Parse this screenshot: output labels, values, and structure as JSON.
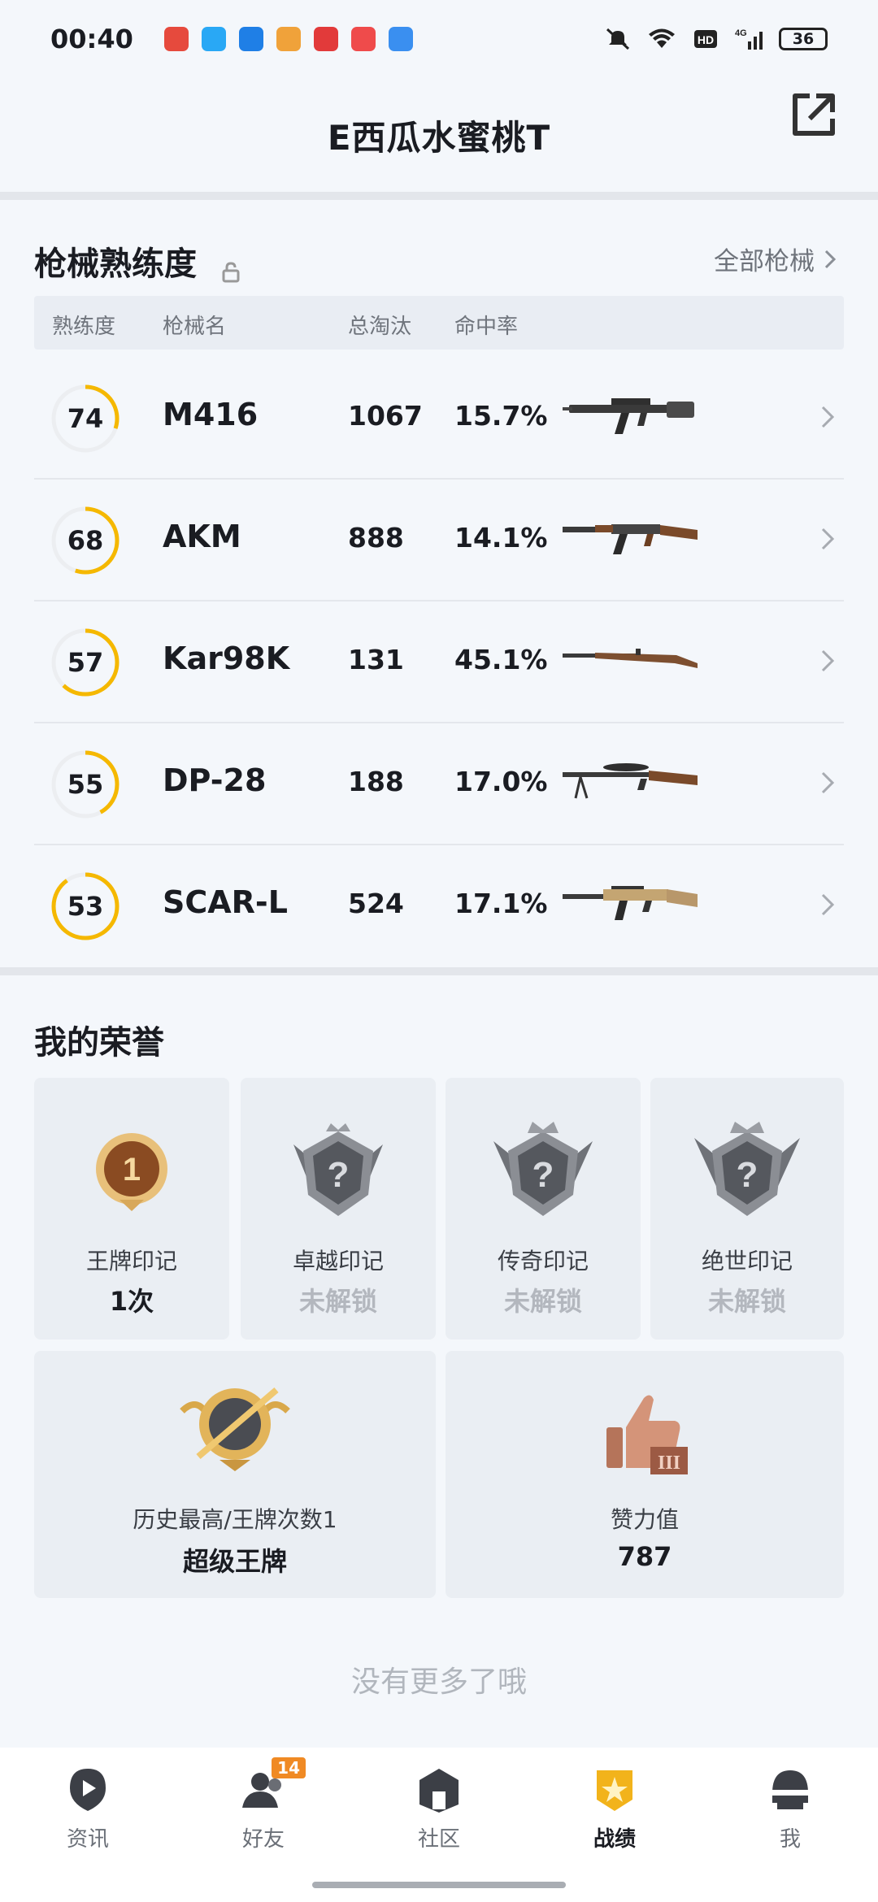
{
  "status_bar": {
    "time": "00:40",
    "battery": "36",
    "network": "4G",
    "hd": "HD",
    "app_colors": [
      "#e64a3d",
      "#29a8f5",
      "#1f7fe6",
      "#f0a23a",
      "#e23a3a",
      "#ef4b4b",
      "#3a8ff0"
    ]
  },
  "header": {
    "title": "E西瓜水蜜桃T",
    "share_icon": "share-external-icon"
  },
  "weapons": {
    "title": "枪械熟练度",
    "all_link": "全部枪械",
    "columns": [
      "熟练度",
      "枪械名",
      "总淘汰",
      "命中率"
    ],
    "rows": [
      {
        "level": "74",
        "name": "M416",
        "kills": "1067",
        "rate": "15.7%",
        "progress": 0.3
      },
      {
        "level": "68",
        "name": "AKM",
        "kills": "888",
        "rate": "14.1%",
        "progress": 0.55
      },
      {
        "level": "57",
        "name": "Kar98K",
        "kills": "131",
        "rate": "45.1%",
        "progress": 0.62
      },
      {
        "level": "55",
        "name": "DP-28",
        "kills": "188",
        "rate": "17.0%",
        "progress": 0.42
      },
      {
        "level": "53",
        "name": "SCAR-L",
        "kills": "524",
        "rate": "17.1%",
        "progress": 0.9
      }
    ]
  },
  "honors": {
    "title": "我的荣誉",
    "small": [
      {
        "label": "王牌印记",
        "value": "1次",
        "locked": false
      },
      {
        "label": "卓越印记",
        "value": "未解锁",
        "locked": true
      },
      {
        "label": "传奇印记",
        "value": "未解锁",
        "locked": true
      },
      {
        "label": "绝世印记",
        "value": "未解锁",
        "locked": true
      }
    ],
    "big": [
      {
        "label": "历史最高/王牌次数1",
        "value": "超级王牌"
      },
      {
        "label": "赞力值",
        "value": "787"
      }
    ]
  },
  "footer": {
    "no_more": "没有更多了哦"
  },
  "tabs": [
    {
      "label": "资讯",
      "badge": ""
    },
    {
      "label": "好友",
      "badge": "14"
    },
    {
      "label": "社区",
      "badge": ""
    },
    {
      "label": "战绩",
      "badge": ""
    },
    {
      "label": "我",
      "badge": ""
    }
  ],
  "colors": {
    "accent": "#f5b800",
    "track": "#eceef1"
  }
}
